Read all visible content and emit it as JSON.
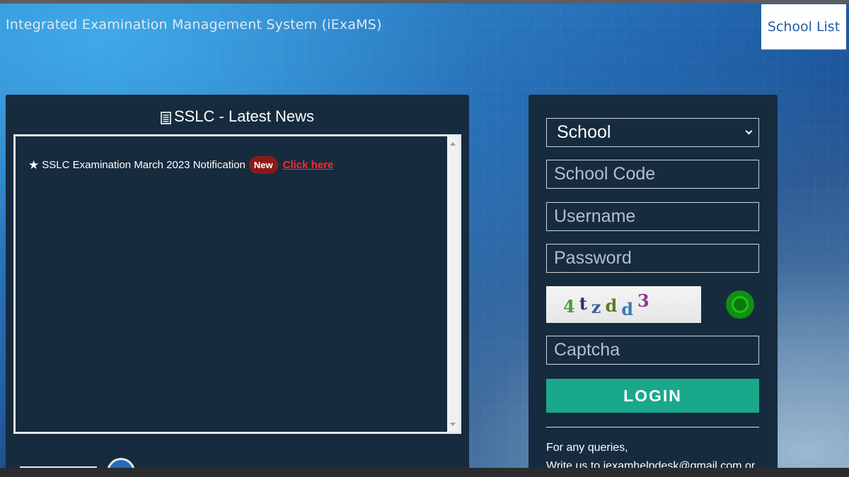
{
  "header": {
    "app_title": "Integrated Examination Management System (iExaMS)",
    "school_list_label": "School List"
  },
  "news": {
    "heading": "SSLC - Latest News",
    "items": [
      {
        "text": "SSLC Examination March 2023 Notification",
        "badge": "New",
        "link_text": "Click here",
        "star": "★"
      }
    ]
  },
  "login": {
    "role_selected": "School",
    "school_code_placeholder": "School Code",
    "username_placeholder": "Username",
    "password_placeholder": "Password",
    "captcha_chars": [
      "4",
      "t",
      "z",
      "d",
      "d",
      "3"
    ],
    "captcha_colors": [
      "#4a9a3a",
      "#2e2e6a",
      "#3a5e9a",
      "#5a7a2a",
      "#3a7ab8",
      "#8a3a8a"
    ],
    "captcha_placeholder": "Captcha",
    "login_label": "LOGIN",
    "query_line1": "For any queries,",
    "query_line2": "Write us to iexamhelpdesk@gmail.com or"
  },
  "icons": {
    "news_heading_icon": "document-list-icon",
    "captcha_refresh_icon": "refresh-icon"
  },
  "colors": {
    "login_button": "#1aa88a",
    "new_badge": "#8b1a1a",
    "link_red": "#ff2a2a",
    "panel_bg": "#162b3e"
  }
}
